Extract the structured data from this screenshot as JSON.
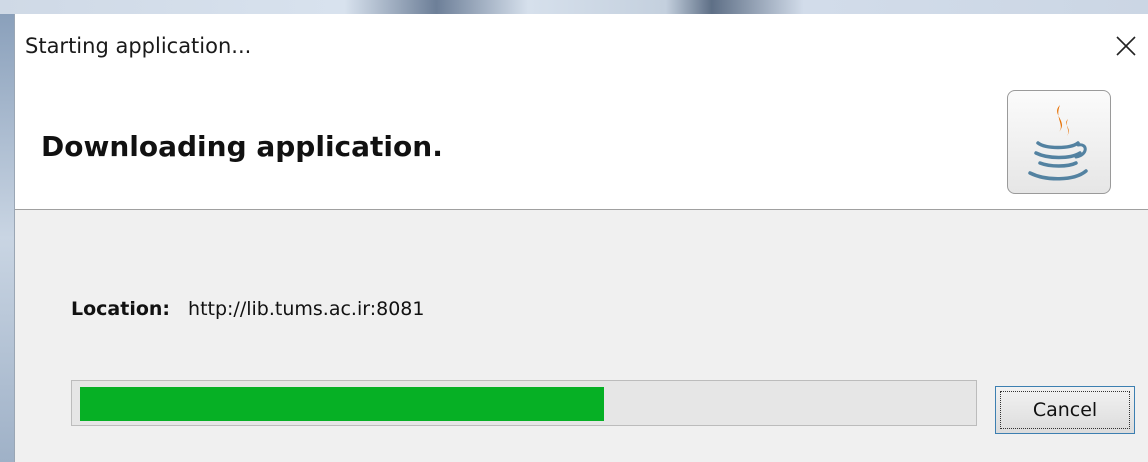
{
  "window": {
    "title": "Starting application..."
  },
  "header": {
    "heading": "Downloading application.",
    "logo_icon": "java-coffee-cup-icon"
  },
  "location": {
    "label": "Location:",
    "value": "http://lib.tums.ac.ir:8081"
  },
  "progress": {
    "fraction": 0.59,
    "fill_color": "#06b025"
  },
  "buttons": {
    "cancel_label": "Cancel"
  },
  "icons": {
    "close": "close-icon"
  }
}
